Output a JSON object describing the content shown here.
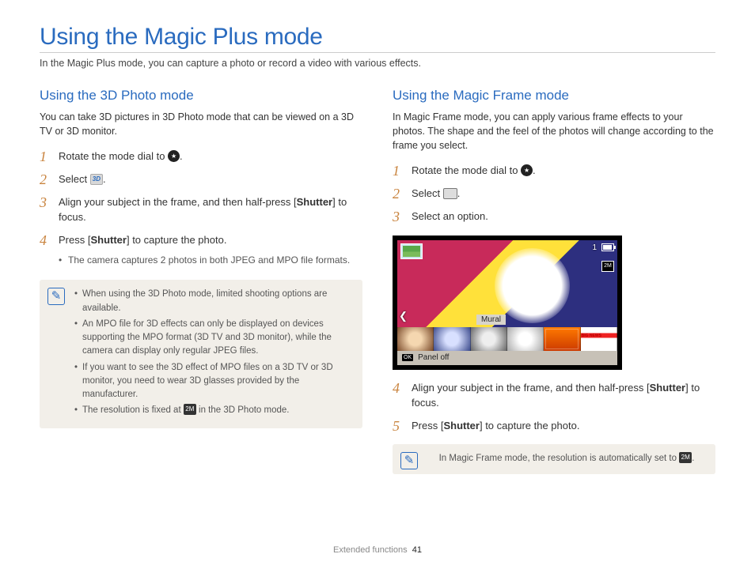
{
  "page": {
    "title": "Using the Magic Plus mode",
    "subtitle": "In the Magic Plus mode, you can capture a photo or record a video with various effects."
  },
  "left": {
    "heading": "Using the 3D Photo mode",
    "intro": "You can take 3D pictures in 3D Photo mode that can be viewed on a 3D TV or 3D monitor.",
    "steps": [
      {
        "n": "1",
        "pre": "Rotate the mode dial to ",
        "post": "."
      },
      {
        "n": "2",
        "pre": "Select ",
        "post": "."
      },
      {
        "n": "3",
        "text": "Align your subject in the frame, and then half-press [",
        "bold": "Shutter",
        "after": "] to focus."
      },
      {
        "n": "4",
        "text": "Press [",
        "bold": "Shutter",
        "after": "] to capture the photo.",
        "sub": [
          "The camera captures 2 photos in both JPEG and MPO file formats."
        ]
      }
    ],
    "callout": [
      "When using the 3D Photo mode, limited shooting options are available.",
      "An MPO file for 3D effects can only be displayed on devices supporting the MPO format (3D TV and 3D monitor), while the camera can display only regular JPEG files.",
      "If you want to see the 3D effect of MPO files on a 3D TV or 3D monitor, you need to wear 3D glasses provided by the manufacturer.",
      "The resolution is fixed at  in the 3D Photo mode."
    ],
    "callout_last_pre": "The resolution is fixed at ",
    "callout_last_post": " in the 3D Photo mode."
  },
  "right": {
    "heading": "Using the Magic Frame mode",
    "intro": "In Magic Frame mode, you can apply various frame effects to your photos. The shape and the feel of the photos will change according to the frame you select.",
    "steps_a": [
      {
        "n": "1",
        "pre": "Rotate the mode dial to ",
        "post": "."
      },
      {
        "n": "2",
        "pre": "Select ",
        "post": "."
      },
      {
        "n": "3",
        "text": "Select an option."
      }
    ],
    "lcd": {
      "count": "1",
      "mural_label": "Mural",
      "panel_off": "Panel off"
    },
    "steps_b": [
      {
        "n": "4",
        "text": "Align your subject in the frame, and then half-press [",
        "bold": "Shutter",
        "after": "] to focus."
      },
      {
        "n": "5",
        "text": "Press [",
        "bold": "Shutter",
        "after": "] to capture the photo."
      }
    ],
    "callout_pre": "In Magic Frame mode, the resolution is automatically set to ",
    "callout_post": "."
  },
  "footer": {
    "section": "Extended functions",
    "page": "41"
  },
  "icons": {
    "mode_dial": "★",
    "three_d": "3D",
    "frame_icon": "▧",
    "res_icon": "2M",
    "note_icon": "✎"
  }
}
